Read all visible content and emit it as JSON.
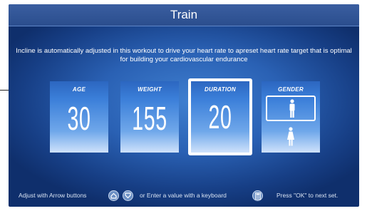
{
  "header": {
    "title": "Train"
  },
  "description": "Incline is automatically adjusted in this workout to drive your heart rate to  apreset heart rate target that is optimal for building your cardiovascular endurance",
  "cards": {
    "age": {
      "label": "AGE",
      "value": "30"
    },
    "weight": {
      "label": "WEIGHT",
      "value": "155"
    },
    "duration": {
      "label": "DURATION",
      "value": "20",
      "selected": true
    },
    "gender": {
      "label": "GENDER",
      "options": [
        "male",
        "female"
      ],
      "selected": "male"
    }
  },
  "footer": {
    "adjust_text": "Adjust with Arrow buttons",
    "or_text": "or  Enter a value with a keyboard",
    "ok_text": "Press \"OK\" to next set."
  },
  "icons": {
    "up": "arrow-up-icon",
    "down": "arrow-down-icon",
    "keyboard": "keypad-icon",
    "male": "male-icon",
    "female": "female-icon"
  },
  "colors": {
    "background": "#2a61b4",
    "titlebar": "#2b4e8e",
    "card_top": "#2c66c0",
    "card_bottom": "#cfe2fb",
    "selected_border": "#ffffff"
  }
}
